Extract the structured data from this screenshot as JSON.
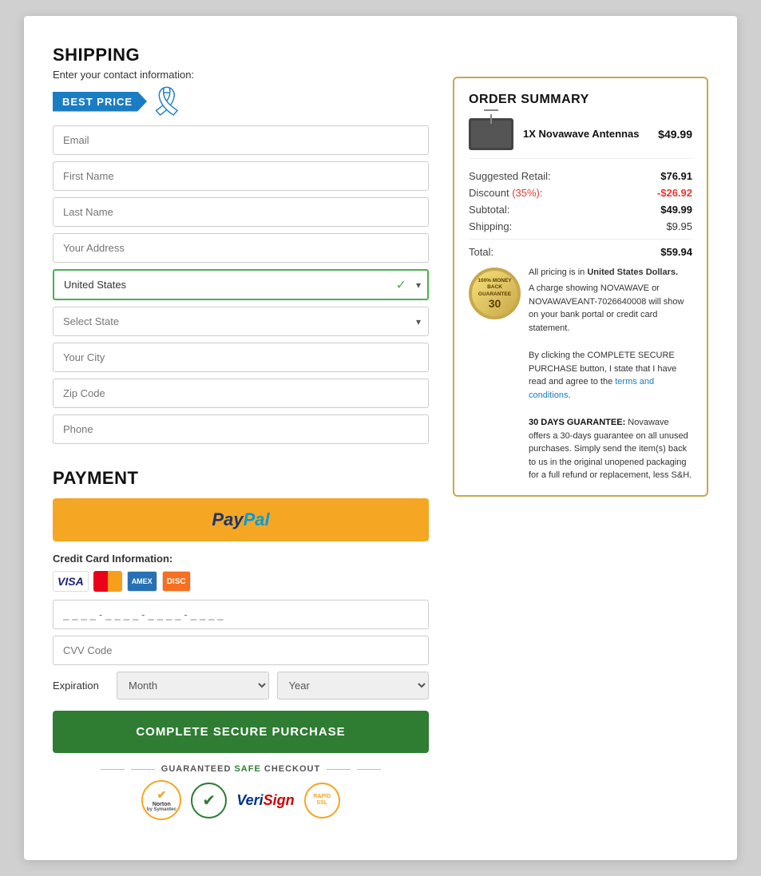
{
  "page": {
    "shipping": {
      "title": "SHIPPING",
      "subtitle": "Enter your contact information:",
      "best_price_label": "BEST PRICE",
      "fields": {
        "email_placeholder": "Email",
        "first_name_placeholder": "First Name",
        "last_name_placeholder": "Last Name",
        "address_placeholder": "Your Address",
        "country_value": "United States",
        "state_placeholder": "Select State",
        "city_placeholder": "Your City",
        "zip_placeholder": "Zip Code",
        "phone_placeholder": "Phone"
      }
    },
    "payment": {
      "title": "PAYMENT",
      "paypal_label": "PayPal",
      "credit_card_label": "Credit Card Information:",
      "card_number_placeholder": "____-____-____-____",
      "cvv_placeholder": "CVV Code",
      "expiration_label": "Expiration",
      "month_placeholder": "Month",
      "year_placeholder": "Year",
      "complete_btn_label": "COMPLETE SECURE PURCHASE",
      "safe_checkout_label": "GUARANTEED SAFE CHECKOUT",
      "safe_label_green": "SAFE"
    },
    "order_summary": {
      "title": "ORDER SUMMARY",
      "product": {
        "name": "1X Novawave Antennas",
        "price": "$49.99"
      },
      "suggested_retail_label": "Suggested Retail:",
      "suggested_retail_value": "$76.91",
      "discount_label": "Discount",
      "discount_pct": "(35%):",
      "discount_value": "-$26.92",
      "subtotal_label": "Subtotal:",
      "subtotal_value": "$49.99",
      "shipping_label": "Shipping:",
      "shipping_value": "$9.95",
      "total_label": "Total:",
      "total_value": "$59.94",
      "pricing_note": "All pricing is in United States Dollars.",
      "charge_note": "A charge showing NOVAWAVE or NOVAWAVEANT-7026640008 will show on your bank portal or credit card statement.",
      "terms_note_before": "By clicking the COMPLETE SECURE PURCHASE button, I state that I have read and agree to the ",
      "terms_link": "terms and conditions",
      "terms_note_after": ".",
      "guarantee_title": "30 DAYS GUARANTEE:",
      "guarantee_days": "30",
      "guarantee_top": "100% MONEY BACK",
      "guarantee_bottom": "GUARANTEE",
      "guarantee_text": "Novawave offers a 30-days guarantee on all unused purchases. Simply send the item(s) back to us in the original unopened packaging for a full refund or replacement, less S&H."
    }
  }
}
